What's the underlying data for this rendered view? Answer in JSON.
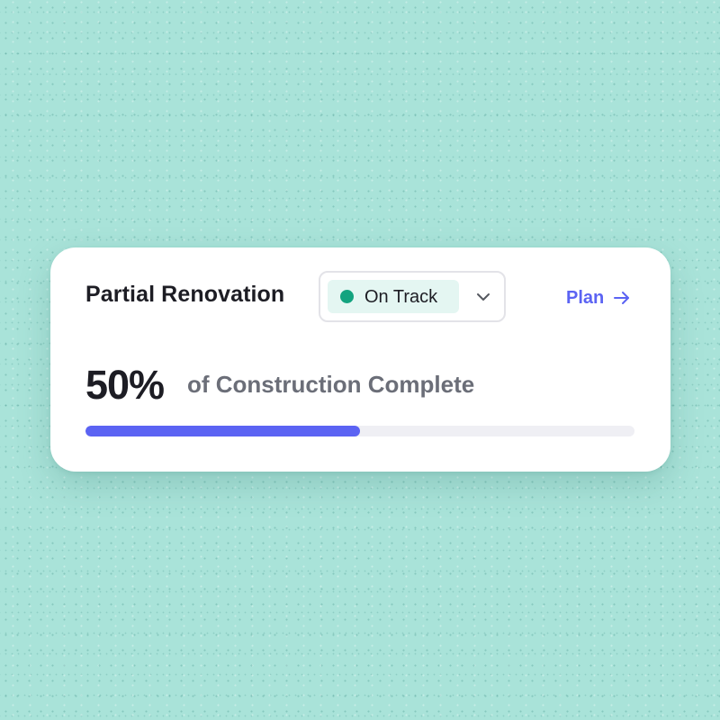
{
  "card": {
    "title": "Partial Renovation",
    "status": {
      "label": "On Track",
      "dot_color": "#13a37f",
      "icon": "chevron-down-icon"
    },
    "plan_link": {
      "label": "Plan",
      "icon": "arrow-right-icon"
    },
    "progress": {
      "percent_label": "50%",
      "caption": "of Construction Complete",
      "fraction": 0.5,
      "bar_color": "#5b63f3"
    }
  },
  "colors": {
    "background": "#a9e3d9",
    "accent": "#5b63f3",
    "status_green": "#13a37f"
  }
}
